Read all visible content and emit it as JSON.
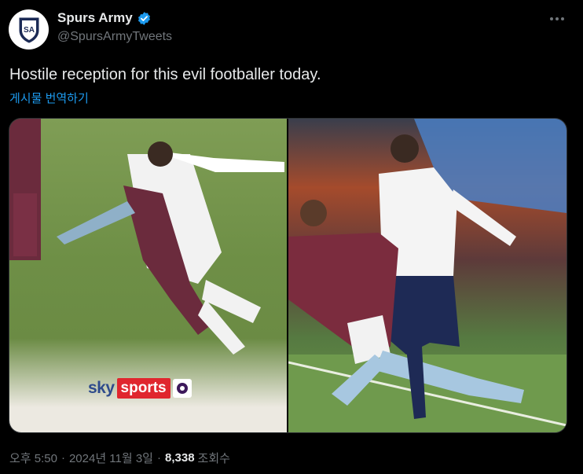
{
  "author": {
    "display_name": "Spurs Army",
    "handle": "@SpursArmyTweets",
    "avatar_initials": "SA",
    "verified_color": "#1d9bf0"
  },
  "tweet": {
    "text": "Hostile reception for this evil footballer today.",
    "translate_label": "게시물 번역하기"
  },
  "media": {
    "left_photo_overlay": {
      "brand_sky": "sky",
      "brand_sports": "sports"
    }
  },
  "meta": {
    "time": "오후 5:50",
    "separator": "·",
    "date": "2024년 11월 3일",
    "views_count": "8,338",
    "views_label": "조회수"
  },
  "colors": {
    "background": "#000000",
    "text_primary": "#e7e9ea",
    "text_secondary": "#71767b",
    "link": "#1d9bf0",
    "sky_red": "#e0262e"
  }
}
